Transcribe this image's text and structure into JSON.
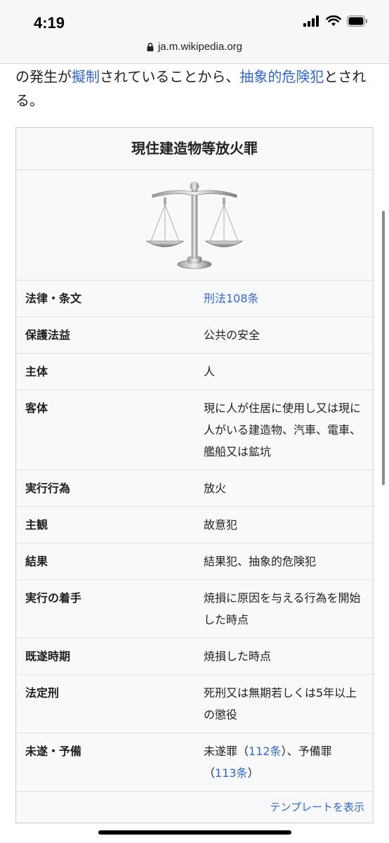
{
  "status": {
    "time": "4:19",
    "url": "ja.m.wikipedia.org"
  },
  "intro": {
    "p1": "の発生が",
    "link1": "擬制",
    "p2": "されていることから、",
    "link2": "抽象的危険犯",
    "p3": "とされる。"
  },
  "infobox": {
    "title": "現住建造物等放火罪",
    "image_icon": "scales-of-justice",
    "rows": [
      {
        "label": "法律・条文",
        "value": "刑法108条"
      },
      {
        "label": "保護法益",
        "value": "公共の安全"
      },
      {
        "label": "主体",
        "value": "人"
      },
      {
        "label": "客体",
        "value": "現に人が住居に使用し又は現に人がいる建造物、汽車、電車、艦船又は鉱坑"
      },
      {
        "label": "実行行為",
        "value": "放火"
      },
      {
        "label": "主観",
        "value": "故意犯"
      },
      {
        "label": "結果",
        "value": "結果犯、抽象的危険犯"
      },
      {
        "label": "実行の着手",
        "value": "焼損に原因を与える行為を開始した時点"
      },
      {
        "label": "既遂時期",
        "value": "焼損した時点"
      },
      {
        "label": "法定刑",
        "value": "死刑又は無期若しくは5年以上の懲役"
      },
      {
        "label": "未遂・予備",
        "v1": "未遂罪（",
        "link_a": "112条",
        "v2": "）、予備罪（",
        "link_b": "113条",
        "v3": "）"
      }
    ],
    "footer_link": "テンプレートを表示"
  },
  "colors": {
    "link": "#3366cc",
    "infobox_bg": "#f8f9fa",
    "border": "#c8ccd1"
  }
}
